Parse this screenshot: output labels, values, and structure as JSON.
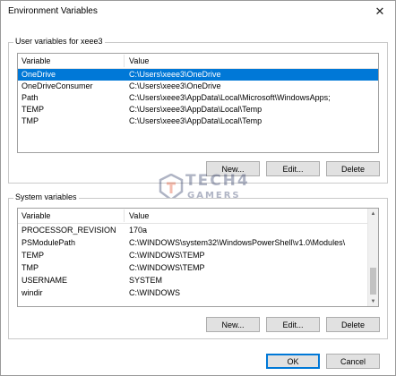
{
  "window": {
    "title": "Environment Variables",
    "close_glyph": "✕"
  },
  "user_vars": {
    "label": "User variables for xeee3",
    "headers": {
      "variable": "Variable",
      "value": "Value"
    },
    "rows": [
      {
        "variable": "OneDrive",
        "value": "C:\\Users\\xeee3\\OneDrive",
        "selected": true
      },
      {
        "variable": "OneDriveConsumer",
        "value": "C:\\Users\\xeee3\\OneDrive",
        "selected": false
      },
      {
        "variable": "Path",
        "value": "C:\\Users\\xeee3\\AppData\\Local\\Microsoft\\WindowsApps;",
        "selected": false
      },
      {
        "variable": "TEMP",
        "value": "C:\\Users\\xeee3\\AppData\\Local\\Temp",
        "selected": false
      },
      {
        "variable": "TMP",
        "value": "C:\\Users\\xeee3\\AppData\\Local\\Temp",
        "selected": false
      }
    ],
    "buttons": {
      "new": "New...",
      "edit": "Edit...",
      "delete": "Delete"
    }
  },
  "system_vars": {
    "label": "System variables",
    "headers": {
      "variable": "Variable",
      "value": "Value"
    },
    "rows": [
      {
        "variable": "PROCESSOR_REVISION",
        "value": "170a"
      },
      {
        "variable": "PSModulePath",
        "value": "C:\\WINDOWS\\system32\\WindowsPowerShell\\v1.0\\Modules\\"
      },
      {
        "variable": "TEMP",
        "value": "C:\\WINDOWS\\TEMP"
      },
      {
        "variable": "TMP",
        "value": "C:\\WINDOWS\\TEMP"
      },
      {
        "variable": "USERNAME",
        "value": "SYSTEM"
      },
      {
        "variable": "windir",
        "value": "C:\\WINDOWS"
      }
    ],
    "buttons": {
      "new": "New...",
      "edit": "Edit...",
      "delete": "Delete"
    }
  },
  "dialog_buttons": {
    "ok": "OK",
    "cancel": "Cancel"
  },
  "watermark": {
    "line1": "TECH4",
    "line2": "GAMERS"
  },
  "colors": {
    "selection": "#0078d7",
    "button_face": "#e1e1e1",
    "default_border": "#0078d7"
  },
  "icons": {
    "close": "close-icon",
    "scroll_up": "scroll-up-arrow-icon",
    "scroll_down": "scroll-down-arrow-icon"
  }
}
